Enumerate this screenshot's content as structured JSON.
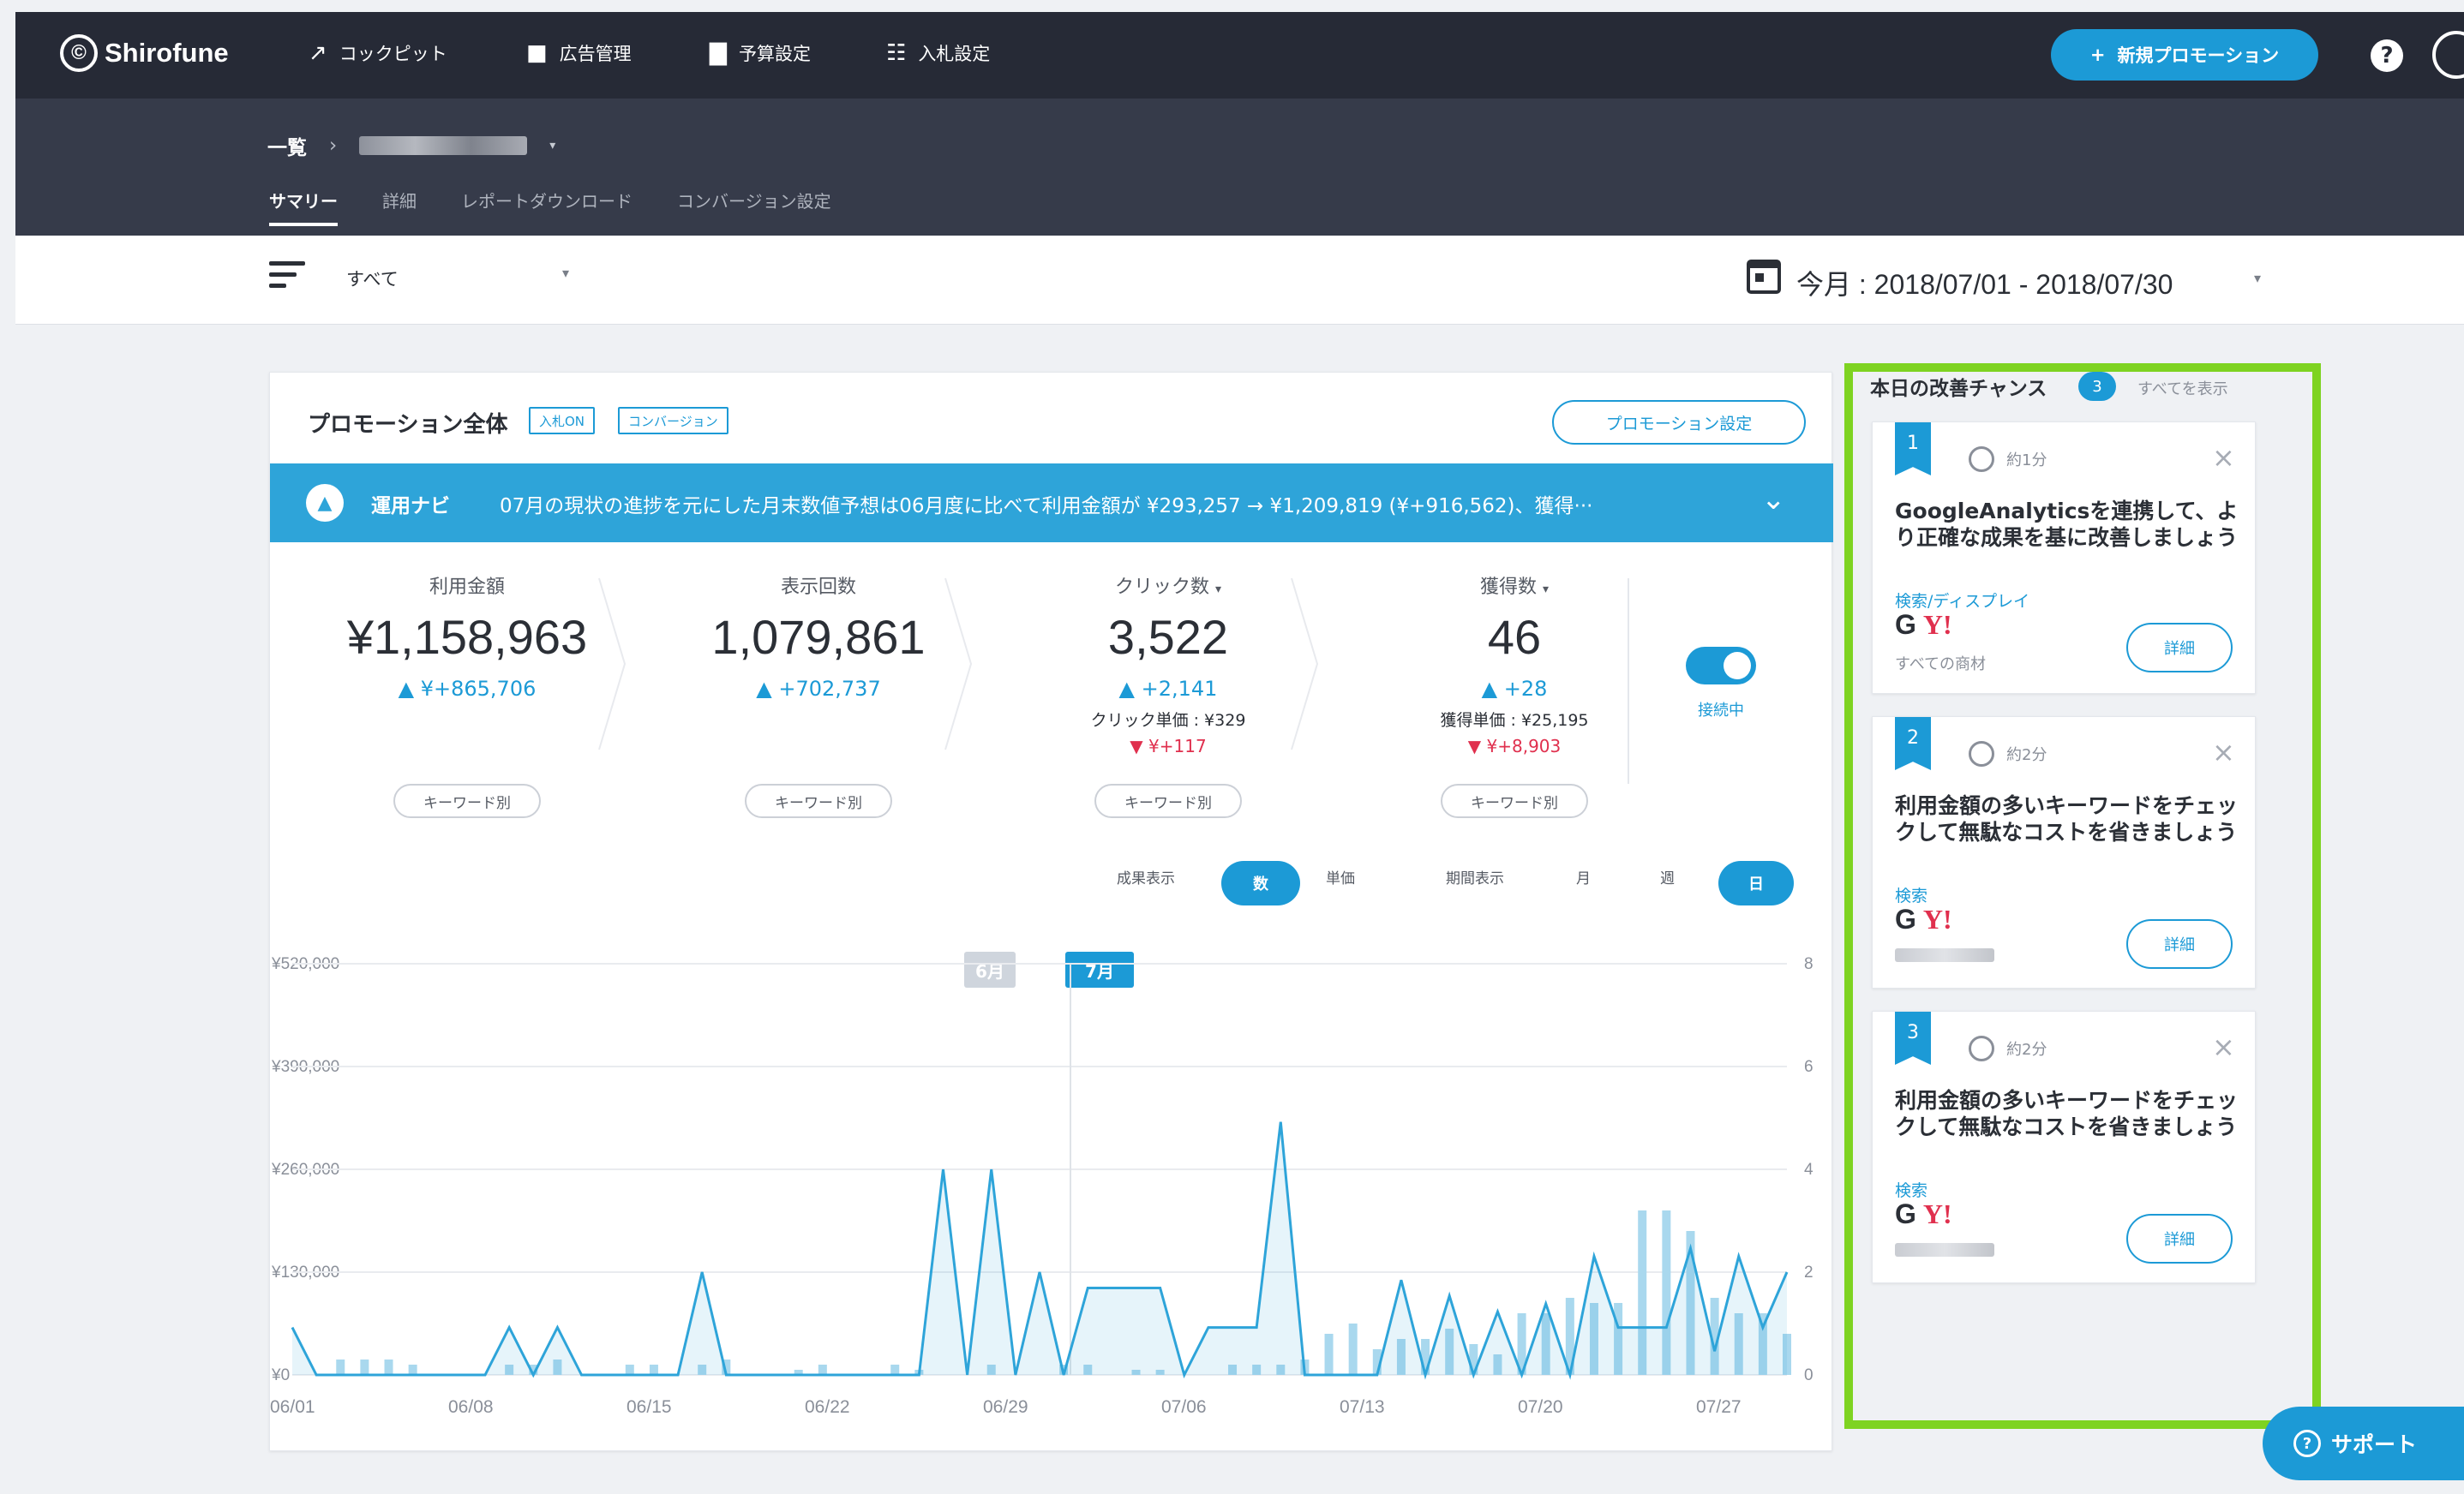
{
  "app": {
    "logo_text": "Shirofune"
  },
  "topnav": {
    "items": [
      {
        "label": "コックピット",
        "icon": "trend-icon"
      },
      {
        "label": "広告管理",
        "icon": "folder-icon"
      },
      {
        "label": "予算設定",
        "icon": "wallet-icon"
      },
      {
        "label": "入札設定",
        "icon": "sliders-icon"
      }
    ],
    "new_promo_label": "新規プロモーション"
  },
  "subnav": {
    "breadcrumb_root": "一覧",
    "tabs": [
      "サマリー",
      "詳細",
      "レポートダウンロード",
      "コンバージョン設定"
    ]
  },
  "filter": {
    "label": "すべて",
    "date_range": "今月 : 2018/07/01 - 2018/07/30"
  },
  "card": {
    "title": "プロモーション全体",
    "tags": [
      "入札ON",
      "コンバージョン"
    ],
    "settings_label": "プロモーション設定",
    "navi_label": "運用ナビ",
    "navi_text": "07月の現状の進捗を元にした月末数値予想は06月度に比べて利用金額が ¥293,257 → ¥1,209,819 (¥+916,562)、獲得···",
    "metrics": [
      {
        "label": "利用金額",
        "value": "¥1,158,963",
        "delta": "¥+865,706",
        "sub": "",
        "sub_delta": ""
      },
      {
        "label": "表示回数",
        "value": "1,079,861",
        "delta": "+702,737",
        "sub": "",
        "sub_delta": ""
      },
      {
        "label": "クリック数",
        "value": "3,522",
        "delta": "+2,141",
        "sub": "クリック単価 : ¥329",
        "sub_delta": "¥+117"
      },
      {
        "label": "獲得数",
        "value": "46",
        "delta": "+28",
        "sub": "獲得単価 : ¥25,195",
        "sub_delta": "¥+8,903"
      }
    ],
    "keyword_label": "キーワード別",
    "connection_label": "接続中",
    "controls": {
      "result_label": "成果表示",
      "count": "数",
      "unit": "単価",
      "period_label": "期間表示",
      "month": "月",
      "week": "週",
      "day": "日"
    }
  },
  "chart_data": {
    "type": "line",
    "y_ticks": [
      "¥520,000",
      "¥390,000",
      "¥260,000",
      "¥130,000",
      "¥0"
    ],
    "y2_ticks": [
      "8",
      "6",
      "4",
      "2",
      "0"
    ],
    "x_ticks": [
      "06/01",
      "06/08",
      "06/15",
      "06/22",
      "06/29",
      "07/06",
      "07/13",
      "07/20",
      "07/27"
    ],
    "month_markers": [
      "6月",
      "7月"
    ],
    "ylim": [
      0,
      520000
    ],
    "y2lim": [
      0,
      8
    ],
    "series": [
      {
        "values": [
          60000,
          0,
          0,
          0,
          0,
          0,
          0,
          0,
          0,
          60000,
          0,
          60000,
          0,
          0,
          0,
          0,
          0,
          130000,
          0,
          0,
          0,
          0,
          0,
          0,
          0,
          0,
          0,
          260000,
          0,
          260000,
          0,
          130000,
          0,
          110000,
          110000,
          110000,
          110000,
          0,
          60000,
          60000,
          60000,
          320000,
          0,
          0,
          0,
          0,
          120000,
          0,
          100000,
          0,
          80000,
          0,
          90000,
          0,
          150000,
          60000,
          60000,
          60000,
          160000,
          30000,
          150000,
          60000,
          130000
        ]
      },
      {
        "values": [
          0,
          0,
          0.3,
          0.3,
          0.3,
          0.2,
          0,
          0,
          0,
          0.2,
          0.2,
          0.3,
          0,
          0,
          0.2,
          0.2,
          0,
          0.2,
          0.3,
          0,
          0,
          0.1,
          0.2,
          0,
          0,
          0.2,
          0.1,
          0,
          0,
          0.2,
          0,
          0,
          0.2,
          0.2,
          0,
          0.1,
          0.1,
          0,
          0,
          0.2,
          0.2,
          0.2,
          0.3,
          0.8,
          1,
          0.5,
          0.7,
          0.7,
          0.9,
          0.6,
          0.4,
          1.2,
          1.2,
          1.5,
          1.4,
          1.4,
          3.2,
          3.2,
          2.8,
          1.5,
          1.2,
          1.2,
          0.8,
          1.8
        ]
      }
    ]
  },
  "chances": {
    "title": "本日の改善チャンス",
    "count": "3",
    "show_all": "すべてを表示",
    "detail_label": "詳細",
    "items": [
      {
        "num": "1",
        "time": "約1分",
        "text": "GoogleAnalyticsを連携して、より正確な成果を基に改善しましょう",
        "kind": "検索/ディスプレイ",
        "target": "すべての商材"
      },
      {
        "num": "2",
        "time": "約2分",
        "text": "利用金額の多いキーワードをチェックして無駄なコストを省きましょう",
        "kind": "検索",
        "target": ""
      },
      {
        "num": "3",
        "time": "約2分",
        "text": "利用金額の多いキーワードをチェックして無駄なコストを省きましょう",
        "kind": "検索",
        "target": ""
      }
    ]
  },
  "support_label": "サポート"
}
